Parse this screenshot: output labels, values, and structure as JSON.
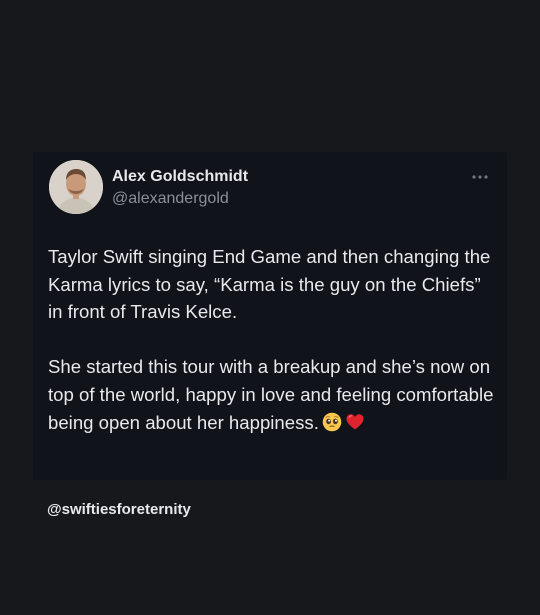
{
  "tweet": {
    "author_name": "Alex Goldschmidt",
    "author_handle": "@alexandergold",
    "paragraph_1": "Taylor Swift singing End Game and then changing the Karma lyrics to say, “Karma is the guy on the Chiefs” in front of Travis Kelce.",
    "paragraph_2": "She started this tour with a breakup and she’s now on top of the world, happy in love and feeling comfortable being open about her happiness.",
    "emojis": [
      "pleading-face-emoji",
      "red-heart-emoji"
    ],
    "more_icon": "more-horizontal-icon"
  },
  "credit": {
    "handle": "@swiftiesforeternity"
  },
  "colors": {
    "background": "#16181c",
    "card": "#10131a",
    "text": "#e7e9ea",
    "muted": "#8b9096"
  }
}
